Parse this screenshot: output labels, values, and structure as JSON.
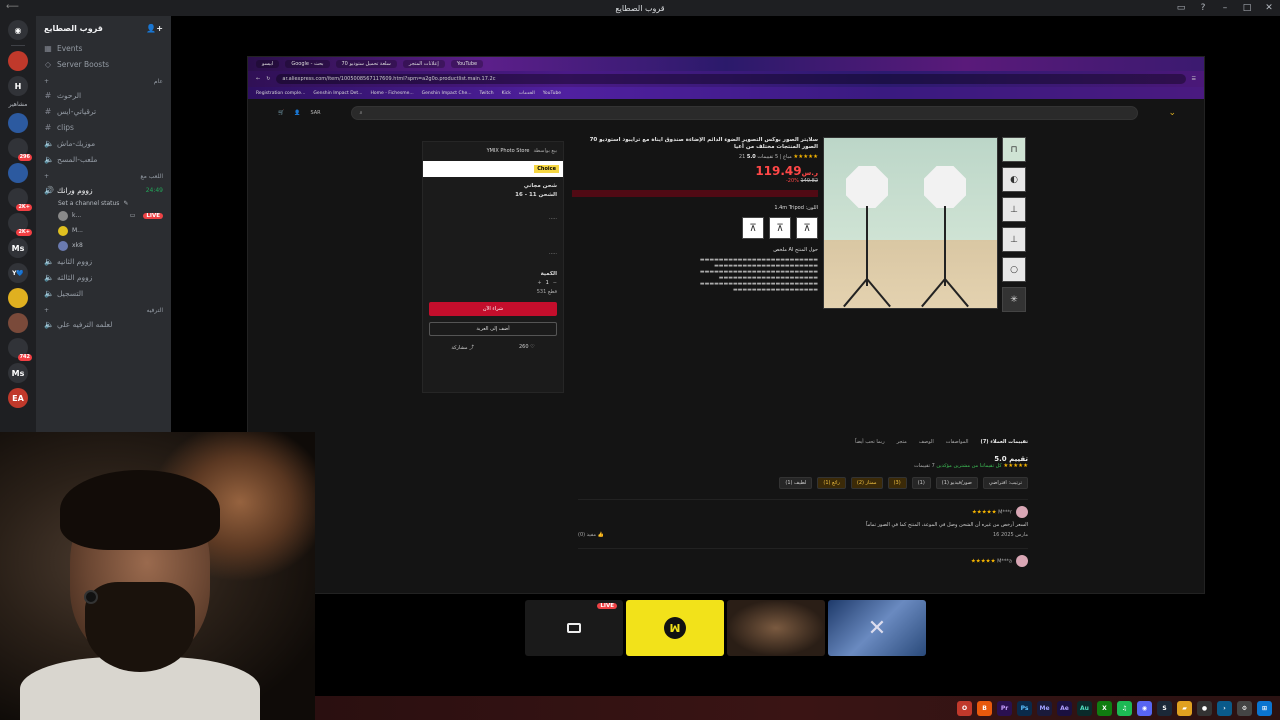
{
  "window": {
    "title": "قروب الصطايع"
  },
  "rail": {
    "dm_icon": "discord-icon",
    "servers": [
      {
        "label": "",
        "color": "red",
        "badge": ""
      },
      {
        "label": "H",
        "color": "",
        "badge": ""
      },
      {
        "label": "",
        "color": "blue",
        "badge": ""
      },
      {
        "label": "",
        "color": "",
        "badge": "296"
      },
      {
        "label": "",
        "color": "blue",
        "badge": ""
      },
      {
        "label": "",
        "color": "",
        "badge": "2K+"
      },
      {
        "label": "",
        "color": "",
        "badge": "2K+"
      },
      {
        "label": "Ms",
        "color": "",
        "badge": ""
      },
      {
        "label": "Y💙",
        "color": "",
        "badge": ""
      },
      {
        "label": "",
        "color": "yellow",
        "badge": ""
      },
      {
        "label": "",
        "color": "",
        "badge": ""
      },
      {
        "label": "",
        "color": "",
        "badge": "742"
      },
      {
        "label": "Ms",
        "color": "",
        "badge": ""
      },
      {
        "label": "EA",
        "color": "red",
        "badge": ""
      }
    ],
    "folder_label": "مشاهير"
  },
  "channels": {
    "guild_name": "قروب الصطايع",
    "events": "Events",
    "boosts": "Server Boosts",
    "category_main": "عام",
    "text_channels": [
      "الرحوث",
      "ترقياتي-ايس",
      "clips"
    ],
    "voice_channels_a": [
      "موزيك-ماش",
      "ملعب-المسح"
    ],
    "category_voice": "اللعب مع",
    "active_voice": "زووم ورانك",
    "active_voice_count": "24:49",
    "channel_status": "Set a channel status",
    "voice_users": [
      {
        "name": "k...",
        "live": true
      },
      {
        "name": "M...",
        "live": false
      },
      {
        "name": "xk8",
        "live": false
      }
    ],
    "voice_channels_b": [
      "زووم الثانيه",
      "زووم الثالثه",
      "التسجيل"
    ],
    "category_extra": "الترفيه",
    "extra_channel": "لعلمه الترفيه علي"
  },
  "live_label": "LIVE",
  "browser": {
    "tabs": [
      "YouTube",
      "إعلانات المتجر",
      "70 سلعة تحميل ستوديو",
      "Google - بحث",
      "ابيسو"
    ],
    "url": "ar.aliexpress.com/item/1005008567117609.html?spm=a2g0o.productlist.main.17.2c",
    "bookmarks": [
      "Registration comple...",
      "Genshin Impact Det...",
      "Home - Fichesme...",
      "Genshin Impact Che...",
      "Twitch",
      "Kick",
      "الخدمات",
      "YouTube"
    ]
  },
  "product": {
    "title": "70 سلايتر الصور بوكس التصوير الضوء الدائم الإضاءة صندوق ايناة مع ترايبود استوديو الصور المنتجات مختلف من أعيا",
    "rating": "5.0",
    "reviews_count": "5 تقييمات",
    "sold": "21 مباع",
    "price": "119.49",
    "currency": "ر.س",
    "old_price": "149.82",
    "discount": "-20%",
    "tripod_label": "1.4m Tripod :اللون",
    "ai_label": "ملخص AI حول المنتج"
  },
  "buybox": {
    "store": "YMIX Photo Store",
    "store_sub": "بيع بواسطة",
    "choice": "Choice",
    "shipping": "شحن مجاني",
    "delivery": "الشحن 11 - 16",
    "quantity_label": "الكمية",
    "quantity": "1",
    "stock": "531 قطع",
    "buy_now": "شراء الآن",
    "add_to_cart": "أضف إلى العربة",
    "likes": "260",
    "share": "مشاركة"
  },
  "reviews": {
    "tabs": [
      "تقييمات العملاء (7)",
      "المواصفات",
      "الوصف",
      "متجر",
      "ربما تحب أيضاً"
    ],
    "title": "تقييم 5.0",
    "count": "7 تقييمات",
    "verified": "كل تقيماتنا من مشترين مؤكدين",
    "filters": [
      "ترتيب: افتراضي",
      "صور/فيديو (1)",
      "(1)",
      "(3)",
      "ممتاز (2)",
      "رائع (1)",
      "لطيف (1)"
    ],
    "reviewer1": "M***r",
    "reviewer1_date": "16 مارس 2025",
    "reviewer1_text": "السعر أرخص من غيره أن الشحن وصل في الموعد، المنتج كما في الصور تماماً",
    "helpful": "مفيد (0)",
    "reviewer2": "M***a"
  },
  "taskbar_icons": [
    "start-icon",
    "opera-icon",
    "brave-icon",
    "premiere-icon",
    "photoshop-icon",
    "media-encoder-icon",
    "after-effects-icon",
    "audition-icon",
    "xbox-icon",
    "spotify-icon",
    "discord-icon",
    "steam-icon",
    "files-icon",
    "obs-icon",
    "terminal-icon",
    "gear-icon"
  ],
  "taskbar_labels": [
    "",
    "",
    "",
    "Pr",
    "Ps",
    "Me",
    "Ae",
    "Au",
    "",
    "",
    "",
    "",
    "",
    "",
    "",
    ""
  ]
}
